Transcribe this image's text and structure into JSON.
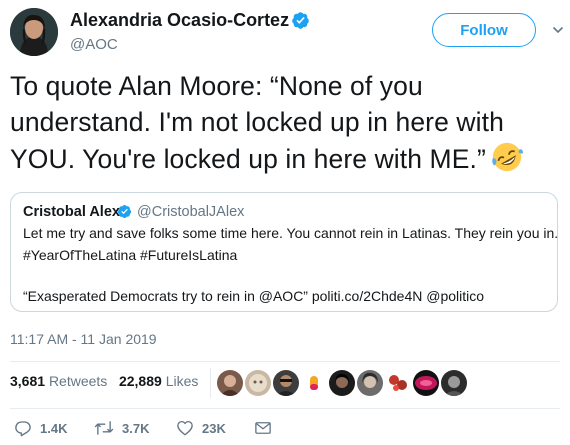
{
  "author": {
    "name": "Alexandria Ocasio-Cortez",
    "handle": "@AOC",
    "verified": true,
    "follow_label": "Follow"
  },
  "tweet": {
    "line1": "To quote Alan Moore: “None of you",
    "line2": "understand. I'm not locked up in here with",
    "line3": "YOU. You're locked up in here with ME.”",
    "emoji": "rolling-on-the-floor-laughing"
  },
  "quoted": {
    "name": "Cristobal Alex",
    "handle": "@CristobalJAlex",
    "verified": true,
    "line1": "Let me try and save folks some time here. You cannot rein in Latinas. They rein you in.",
    "hashtag1": "#YearOfTheLatina",
    "hashtag2": "#FutureIsLatina",
    "line3_text": "“Exasperated Democrats try to rein in @AOC” politi.co/2Chde4N @politico"
  },
  "timestamp": "11:17 AM - 11 Jan 2019",
  "stats": {
    "retweets_count": "3,681",
    "retweets_label": "Retweets",
    "likes_count": "22,889",
    "likes_label": "Likes"
  },
  "actions": {
    "replies": "1.4K",
    "retweets": "3.7K",
    "likes": "23K"
  },
  "colors": {
    "accent": "#1da1f2",
    "text": "#14171a",
    "muted": "#657786",
    "border": "#e6ecf0"
  }
}
